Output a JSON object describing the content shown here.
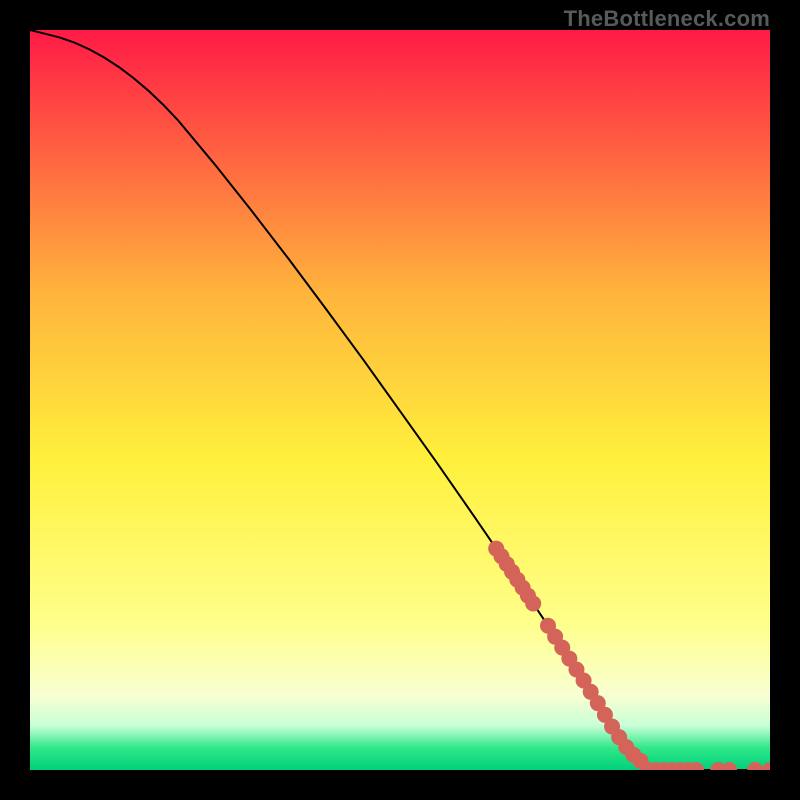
{
  "watermark": "TheBottleneck.com",
  "colors": {
    "gradient_top": "#ff1a46",
    "gradient_mid_upper": "#ffb23c",
    "gradient_mid": "#fff03c",
    "gradient_mid_lower_a": "#ffff8a",
    "gradient_mid_lower_b": "#f8ffd2",
    "gradient_low_a": "#c8ffd6",
    "gradient_low_b": "#30e88a",
    "gradient_bottom": "#00d07a",
    "curve": "#000000",
    "dots": "#d4645a"
  },
  "chart_data": {
    "type": "line",
    "title": "",
    "xlabel": "",
    "ylabel": "",
    "xlim": [
      0,
      100
    ],
    "ylim": [
      0,
      100
    ],
    "series": [
      {
        "name": "bottleneck-curve",
        "x": [
          0,
          2,
          4,
          6,
          8,
          10,
          12,
          14,
          16,
          18,
          20,
          25,
          30,
          35,
          40,
          45,
          50,
          55,
          60,
          65,
          70,
          75,
          77,
          79,
          81,
          83,
          85,
          90,
          95,
          100
        ],
        "y": [
          100,
          99.5,
          99,
          98.3,
          97.4,
          96.3,
          95,
          93.5,
          91.8,
          89.9,
          87.8,
          81.8,
          75.5,
          69,
          62.3,
          55.5,
          48.5,
          41.5,
          34.3,
          27,
          19.5,
          11.8,
          8.6,
          5.3,
          2.5,
          0.8,
          0,
          0,
          0,
          0
        ]
      }
    ],
    "dot_clusters": [
      {
        "name": "upper-cluster",
        "x_range": [
          63.0,
          68.0
        ],
        "y_range": [
          22.5,
          30.0
        ],
        "count": 8
      },
      {
        "name": "lower-diagonal-cluster",
        "x_range": [
          70.0,
          82.5
        ],
        "y_range": [
          1.5,
          19.0
        ],
        "count": 14
      },
      {
        "name": "flat-cluster-a",
        "x_range": [
          83.5,
          90.0
        ],
        "y_range": [
          0.0,
          0.0
        ],
        "count": 7
      },
      {
        "name": "flat-cluster-b",
        "x_range": [
          93.0,
          94.5
        ],
        "y_range": [
          0.0,
          0.0
        ],
        "count": 2
      },
      {
        "name": "flat-cluster-c",
        "x_range": [
          98.0,
          100.0
        ],
        "y_range": [
          0.0,
          0.0
        ],
        "count": 2
      }
    ],
    "gradient_description": "vertical rainbow from red at top through orange/yellow to narrow green band at bottom"
  }
}
